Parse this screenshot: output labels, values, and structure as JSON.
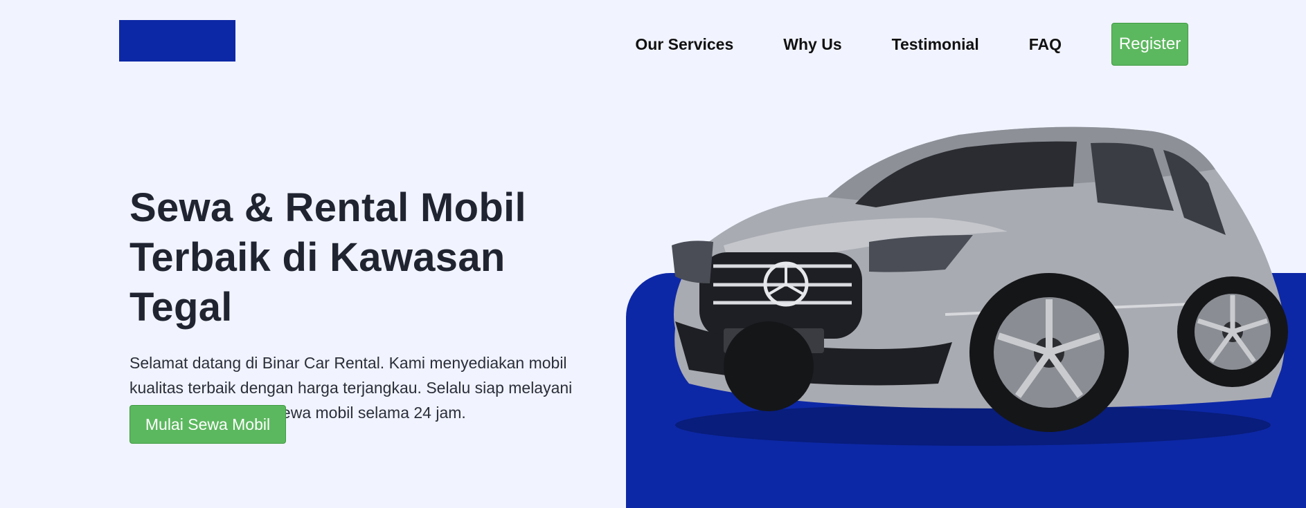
{
  "nav": {
    "links": [
      "Our Services",
      "Why Us",
      "Testimonial",
      "FAQ"
    ],
    "register_label": "Register"
  },
  "hero": {
    "title_line1": "Sewa & Rental Mobil",
    "title_line2": "Terbaik di Kawasan Tegal",
    "description": "Selamat datang di Binar Car Rental. Kami menyediakan mobil kualitas terbaik dengan harga terjangkau. Selalu siap melayani kebutuhanmu untuk sewa mobil selama 24 jam.",
    "cta_label": "Mulai Sewa Mobil"
  },
  "colors": {
    "brand_blue": "#0d28a6",
    "button_green": "#5cb85f",
    "background": "#f1f3ff"
  }
}
